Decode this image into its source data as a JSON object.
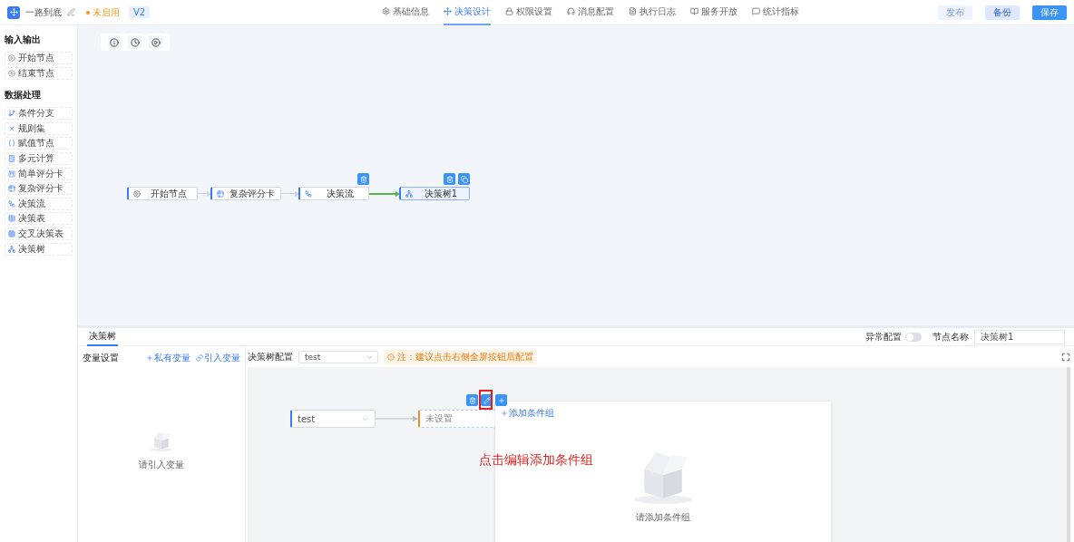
{
  "header": {
    "app_name": "一路到底",
    "status": "未启用",
    "version": "V2",
    "nav": [
      {
        "label": "基础信息",
        "selected": false
      },
      {
        "label": "决策设计",
        "selected": true
      },
      {
        "label": "权限设置",
        "selected": false
      },
      {
        "label": "消息配置",
        "selected": false
      },
      {
        "label": "执行日志",
        "selected": false
      },
      {
        "label": "服务开放",
        "selected": false
      },
      {
        "label": "统计指标",
        "selected": false
      }
    ],
    "buttons": [
      {
        "label": "发布",
        "disabled": true,
        "primary": false
      },
      {
        "label": "备份",
        "disabled": false,
        "primary": false
      },
      {
        "label": "保存",
        "disabled": false,
        "primary": true
      }
    ]
  },
  "sidebar": {
    "groups": [
      {
        "title": "输入输出",
        "items": [
          "开始节点",
          "结束节点"
        ]
      },
      {
        "title": "数据处理",
        "items": [
          "条件分支",
          "规则集",
          "赋值节点",
          "多元计算",
          "简单评分卡",
          "复杂评分卡",
          "决策流",
          "决策表",
          "交叉决策表",
          "决策树"
        ]
      }
    ]
  },
  "flow": {
    "nodes": [
      {
        "label": "开始节点",
        "selected": false
      },
      {
        "label": "复杂评分卡",
        "selected": false
      },
      {
        "label": "决策流",
        "selected": false
      },
      {
        "label": "决策树1",
        "selected": true
      }
    ],
    "edges": [
      {
        "active": false
      },
      {
        "active": false
      },
      {
        "active": true
      }
    ]
  },
  "panel": {
    "tabs": [
      {
        "label": "决策树",
        "selected": true
      }
    ],
    "exception": {
      "label": "异常配置",
      "on": false
    },
    "node_name": {
      "label": "节点名称",
      "value": "决策树1"
    },
    "variables": {
      "title": "变量设置",
      "actions": [
        "私有变量",
        "引入变量"
      ],
      "empty_text": "请引入变量"
    },
    "config": {
      "label": "决策树配置",
      "select_value": "test",
      "note": "注：建议点击右侧全屏按钮后配置",
      "tree": {
        "root": "test",
        "child": "未设置",
        "popup": {
          "add_label": "添加条件组",
          "empty_text": "请添加条件组"
        }
      },
      "annotation": "点击编辑添加条件组"
    }
  }
}
